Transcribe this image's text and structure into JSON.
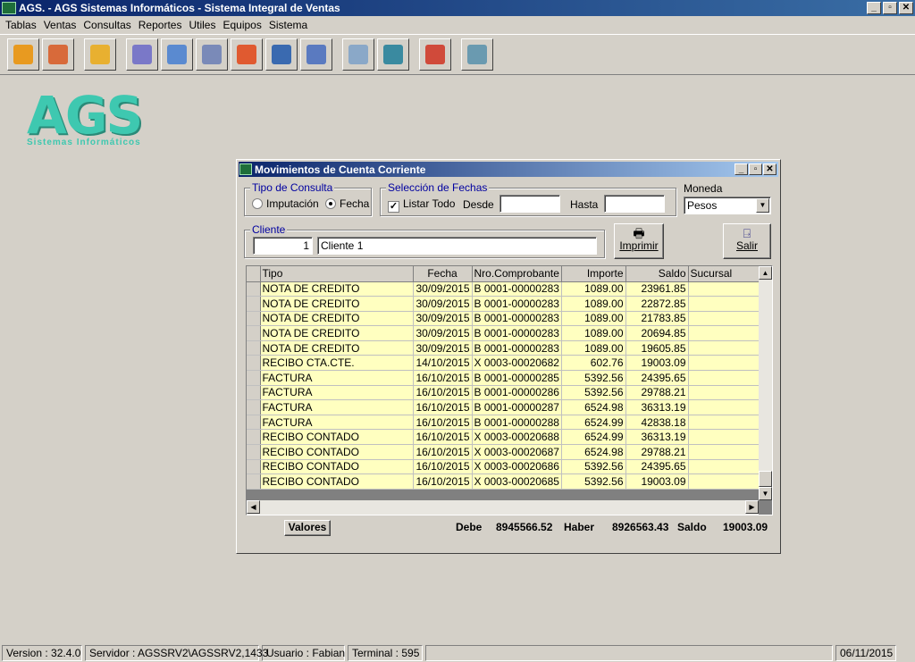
{
  "window": {
    "title": "AGS. - AGS Sistemas Informáticos - Sistema Integral de Ventas",
    "min": "_",
    "restore": "▫",
    "close": "✕"
  },
  "menu": [
    "Tablas",
    "Ventas",
    "Consultas",
    "Reportes",
    "Utiles",
    "Equipos",
    "Sistema"
  ],
  "toolbar_icons": [
    {
      "name": "add-product-icon",
      "color": "#e89a20"
    },
    {
      "name": "users-icon",
      "color": "#d86a3a"
    },
    {
      "name": "box-icon",
      "color": "#e8b030"
    },
    {
      "name": "cash-register-icon",
      "color": "#7a78c8"
    },
    {
      "name": "price-tag-icon",
      "color": "#5a8ad0"
    },
    {
      "name": "windows-icon",
      "color": "#7a8ab8"
    },
    {
      "name": "pencil-icon",
      "color": "#e05a30"
    },
    {
      "name": "book-icon",
      "color": "#3a6ab0"
    },
    {
      "name": "edit-document-icon",
      "color": "#5a7ac0"
    },
    {
      "name": "folder-icon",
      "color": "#8aa8c8"
    },
    {
      "name": "database-icon",
      "color": "#3a8aa0"
    },
    {
      "name": "tools-icon",
      "color": "#d04a3a"
    },
    {
      "name": "key-icon",
      "color": "#6a9ab0"
    }
  ],
  "logo": {
    "big": "AGS",
    "small": "Sistemas Informáticos"
  },
  "dialog": {
    "title": "Movimientos de Cuenta Corriente",
    "tipo_consulta": {
      "legend": "Tipo de Consulta",
      "imputacion": "Imputación",
      "fecha": "Fecha",
      "selected": "fecha"
    },
    "fechas": {
      "legend": "Selección de Fechas",
      "listar_todo": "Listar Todo",
      "checked": true,
      "desde_label": "Desde",
      "desde": "",
      "hasta_label": "Hasta",
      "hasta": ""
    },
    "moneda": {
      "label": "Moneda",
      "value": "Pesos"
    },
    "cliente": {
      "legend": "Cliente",
      "code": "1",
      "name": "Cliente 1"
    },
    "imprimir": "Imprimir",
    "salir": "Salir",
    "columns": [
      "Tipo",
      "Fecha",
      "Nro.Comprobante",
      "Importe",
      "Saldo",
      "Sucursal"
    ],
    "rows": [
      [
        "NOTA DE CREDITO",
        "30/09/2015",
        "B 0001-00000283",
        "1089.00",
        "23961.85",
        ""
      ],
      [
        "NOTA DE CREDITO",
        "30/09/2015",
        "B 0001-00000283",
        "1089.00",
        "22872.85",
        ""
      ],
      [
        "NOTA DE CREDITO",
        "30/09/2015",
        "B 0001-00000283",
        "1089.00",
        "21783.85",
        ""
      ],
      [
        "NOTA DE CREDITO",
        "30/09/2015",
        "B 0001-00000283",
        "1089.00",
        "20694.85",
        ""
      ],
      [
        "NOTA DE CREDITO",
        "30/09/2015",
        "B 0001-00000283",
        "1089.00",
        "19605.85",
        ""
      ],
      [
        "RECIBO CTA.CTE.",
        "14/10/2015",
        "X 0003-00020682",
        "602.76",
        "19003.09",
        ""
      ],
      [
        "FACTURA",
        "16/10/2015",
        "B 0001-00000285",
        "5392.56",
        "24395.65",
        ""
      ],
      [
        "FACTURA",
        "16/10/2015",
        "B 0001-00000286",
        "5392.56",
        "29788.21",
        ""
      ],
      [
        "FACTURA",
        "16/10/2015",
        "B 0001-00000287",
        "6524.98",
        "36313.19",
        ""
      ],
      [
        "FACTURA",
        "16/10/2015",
        "B 0001-00000288",
        "6524.99",
        "42838.18",
        ""
      ],
      [
        "RECIBO CONTADO",
        "16/10/2015",
        "X 0003-00020688",
        "6524.99",
        "36313.19",
        ""
      ],
      [
        "RECIBO CONTADO",
        "16/10/2015",
        "X 0003-00020687",
        "6524.98",
        "29788.21",
        ""
      ],
      [
        "RECIBO CONTADO",
        "16/10/2015",
        "X 0003-00020686",
        "5392.56",
        "24395.65",
        ""
      ],
      [
        "RECIBO CONTADO",
        "16/10/2015",
        "X 0003-00020685",
        "5392.56",
        "19003.09",
        ""
      ]
    ],
    "valores": "Valores",
    "totals": {
      "debe_label": "Debe",
      "debe": "8945566.52",
      "haber_label": "Haber",
      "haber": "8926563.43",
      "saldo_label": "Saldo",
      "saldo": "19003.09"
    }
  },
  "status": {
    "version": "Version : 32.4.0",
    "servidor": "Servidor : AGSSRV2\\AGSSRV2,1433",
    "usuario": "Usuario : Fabian",
    "terminal": "Terminal : 595",
    "date": "06/11/2015"
  }
}
